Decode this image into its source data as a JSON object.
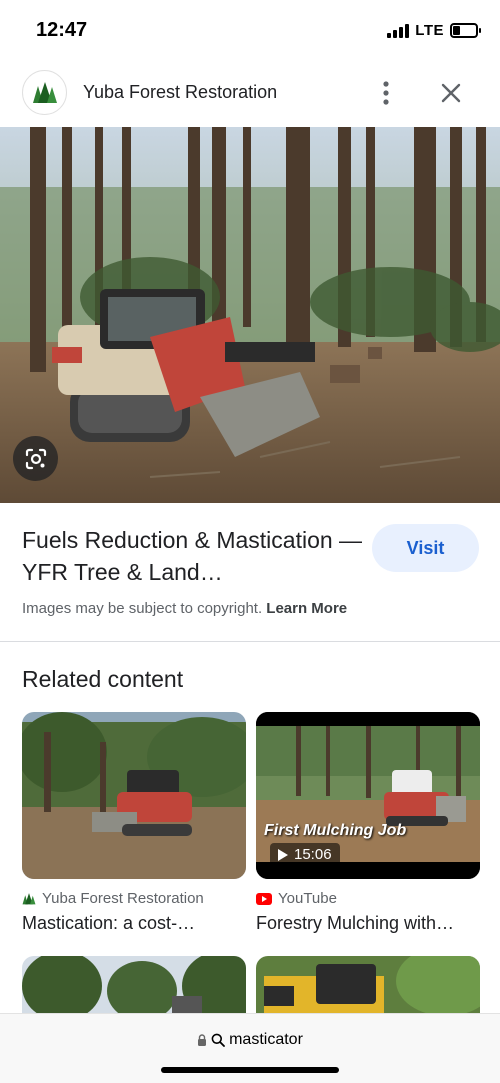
{
  "status_bar": {
    "time": "12:47",
    "network": "LTE",
    "icons": [
      "signal-icon",
      "battery-icon"
    ]
  },
  "header": {
    "site_name": "Yuba Forest Restoration",
    "icons": [
      "site-logo-icon",
      "more-vert-icon",
      "close-icon"
    ]
  },
  "hero": {
    "icons": [
      "lens-icon"
    ]
  },
  "result": {
    "title": "Fuels Reduction & Mastication — YFR Tree & Land…",
    "visit_label": "Visit",
    "copyright_text": "Images may be subject to copyright.",
    "learn_more": "Learn More"
  },
  "related": {
    "heading": "Related content",
    "cards": [
      {
        "source": "Yuba Forest Restoration",
        "title": "Mastication: a cost-…",
        "source_icon": "tree-logo-icon"
      },
      {
        "source": "YouTube",
        "title": "Forestry Mulching with…",
        "source_icon": "youtube-icon",
        "duration": "15:06",
        "overlay_text": "First Mulching Job"
      }
    ]
  },
  "bottom_bar": {
    "url": "masticator",
    "icons": [
      "lock-icon",
      "search-icon"
    ]
  },
  "colors": {
    "accent": "#1a5fcf",
    "visit_bg": "#e8f0fe",
    "youtube_red": "#ff0000",
    "logo_green": "#2e7d32"
  }
}
